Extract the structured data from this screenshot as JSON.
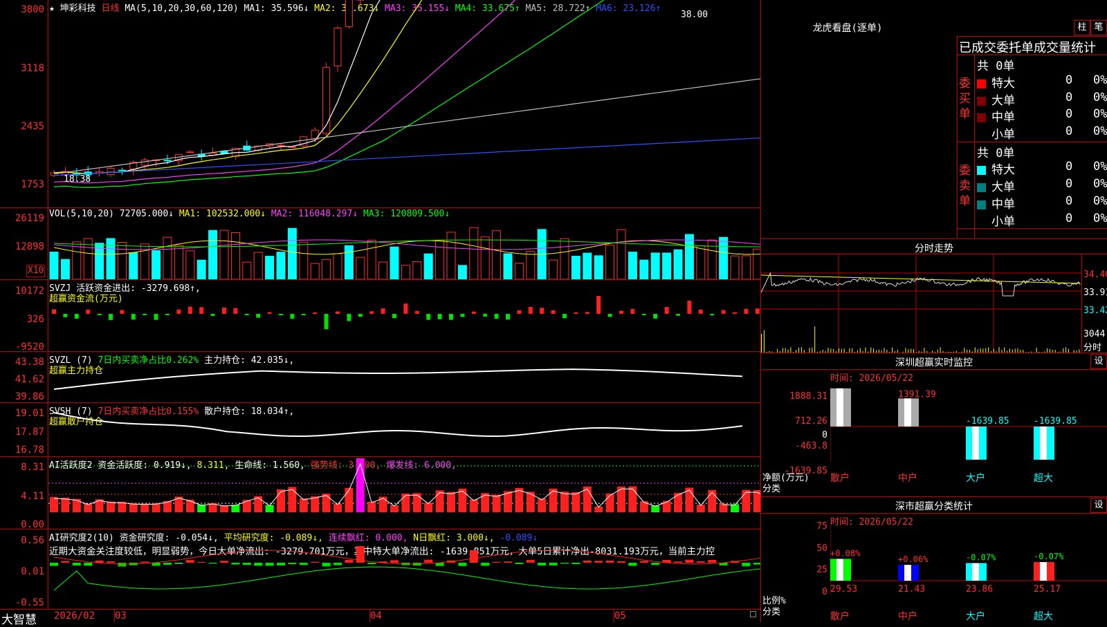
{
  "stock": {
    "star": "★",
    "name": "坤彩科技",
    "period": "日线"
  },
  "ma_header": {
    "label": "MA(5,10,20,30,60,120)",
    "ma1": "MA1: 35.596↓",
    "ma2": "MA2: 35.673↓",
    "ma3": "MA3: 35.155↓",
    "ma4": "MA4: 33.675↑",
    "ma5": "MA5: 28.722↑",
    "ma6": "MA6: 23.126↑",
    "high_mark": "38.00",
    "low_mark": "18.38"
  },
  "price_axis": [
    "3800",
    "3118",
    "2435",
    "1753"
  ],
  "vol_header": {
    "label": "VOL(5,10,20)",
    "vol": "72705.000↓",
    "ma1": "MA1: 102532.000↓",
    "ma2": "MA2: 116048.297↓",
    "ma3": "MA3: 120809.500↓"
  },
  "vol_axis": [
    "26119",
    "12898"
  ],
  "vol_unit": "X10",
  "svzj": {
    "label": "SVZJ  活跃资金进出: -3279.698↑,",
    "sub": "超赢资金流(万元)",
    "axis": [
      "10172",
      "326",
      "-9520"
    ]
  },
  "svzl": {
    "label": "SVZL (7)",
    "ratio": "7日内买卖净占比0.262%",
    "hold": "主力持仓: 42.035↓,",
    "sub": "超赢主力持仓",
    "axis": [
      "43.38",
      "41.62",
      "39.86"
    ]
  },
  "svsh": {
    "label": "SVSH (7)",
    "ratio": "7日内买卖净占比0.155%",
    "hold": "散户持仓: 18.034↑,",
    "sub": "超赢散户持仓",
    "axis": [
      "19.01",
      "17.87",
      "16.78"
    ]
  },
  "ai_active": {
    "label": "AI活跃度2 资金活跃度: 0.919↓,",
    "v2": "8.311,",
    "life": "生命线: 1.560,",
    "strong": "强势线: 3.000,",
    "burst": "爆发线: 6.000,",
    "axis": [
      "8.31",
      "4.11",
      "0.00"
    ]
  },
  "ai_research": {
    "label": "AI研究度2(10) 资金研究度: -0.054↓,",
    "avg": "平均研究度: -0.089↓,",
    "red": "连续飘红: 0.000,",
    "nred": "N日飘红: 3.000↓,",
    "last": "-0.089↓",
    "comment": "近期大资金关注度较低，明显弱势，今日大单净流出: -3279.701万元，其中特大单净流出: -1639.851万元，大单5日累计净出-8031.193万元，当前主力控",
    "axis": [
      "0.56",
      "0.01",
      "-0.55"
    ]
  },
  "bottom": {
    "brand": "大智慧",
    "dates": [
      "2026/02",
      "03",
      "04",
      "05"
    ]
  },
  "longhu": {
    "title": "龙虎看盘(逐单)",
    "btn_bar": "柱",
    "btn_pen": "笔",
    "tabs": "已成交委托单成交量统计",
    "buy_side": "委买单",
    "sell_side": "委卖单",
    "buy_total": "共 0单",
    "sell_total": "共 0单",
    "buy_rows": [
      {
        "name": "特大",
        "v": "0",
        "p": "0%",
        "color": "#ff0000"
      },
      {
        "name": "大单",
        "v": "0",
        "p": "0%",
        "color": "#800000"
      },
      {
        "name": "中单",
        "v": "0",
        "p": "0%",
        "color": "#800000"
      },
      {
        "name": "小单",
        "v": "0",
        "p": "0%",
        "color": "#000000"
      }
    ],
    "sell_rows": [
      {
        "name": "特大",
        "v": "0",
        "p": "0%",
        "color": "#00ffff"
      },
      {
        "name": "大单",
        "v": "0",
        "p": "0%",
        "color": "#008080"
      },
      {
        "name": "中单",
        "v": "0",
        "p": "0%",
        "color": "#008080"
      },
      {
        "name": "小单",
        "v": "0",
        "p": "0%",
        "color": "#000000"
      }
    ]
  },
  "intraday": {
    "title": "分时走势",
    "prices": [
      "34.40",
      "33.91",
      "33.42"
    ],
    "vol": "3044",
    "vol_unit": "分时"
  },
  "sz_monitor": {
    "title": "深圳超赢实时监控",
    "btn": "设",
    "time": "时间: 2026/05/22",
    "axis": [
      "1888.31",
      "712.26",
      "0",
      "-463.8",
      "-1639.85"
    ],
    "unit": "净额(万元)",
    "cat_label": "分类",
    "chart_data": {
      "type": "bar",
      "categories": [
        "散户",
        "中户",
        "大户",
        "超大"
      ],
      "values": [
        1888.31,
        1391.39,
        -1639.85,
        -1639.85
      ],
      "labels": [
        "1888.31",
        "1391.39",
        "-1639.85",
        "-1639.85"
      ]
    }
  },
  "sz_class": {
    "title": "深市超赢分类统计",
    "btn": "设",
    "time": "时间: 2026/05/22",
    "axis": [
      "75",
      "50",
      "25",
      "0"
    ],
    "unit": "比例%",
    "cat_label": "分类",
    "chart_data": {
      "type": "bar",
      "categories": [
        "散户",
        "中户",
        "大户",
        "超大"
      ],
      "values": [
        29.53,
        21.43,
        23.86,
        25.17
      ],
      "changes": [
        "+0.08%",
        "+0.06%",
        "-0.07%",
        "-0.07%"
      ],
      "labels": [
        "29.53",
        "21.43",
        "23.86",
        "25.17"
      ]
    }
  }
}
